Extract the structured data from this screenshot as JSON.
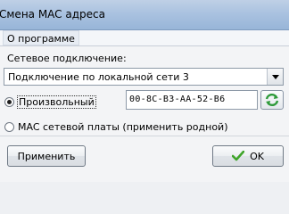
{
  "window": {
    "title": "Смена MAC адреса"
  },
  "menu": {
    "items": [
      {
        "label": "О программе"
      }
    ]
  },
  "connection": {
    "label": "Сетевое подключение:",
    "selected": "Подключение по локальной сети 3"
  },
  "options": {
    "custom": {
      "label": "Произвольный",
      "checked": true
    },
    "original": {
      "label": "MAC сетевой платы (применить родной)",
      "checked": false
    }
  },
  "mac": {
    "value": "00-8C-B3-AA-52-B6"
  },
  "buttons": {
    "apply": "Применить",
    "ok": "OK"
  },
  "icons": {
    "dropdown": "chevron-down-icon",
    "refresh": "refresh-icon",
    "ok": "checkmark-icon"
  },
  "colors": {
    "ok_check": "#3fa52a",
    "refresh": "#2e9a3a"
  }
}
